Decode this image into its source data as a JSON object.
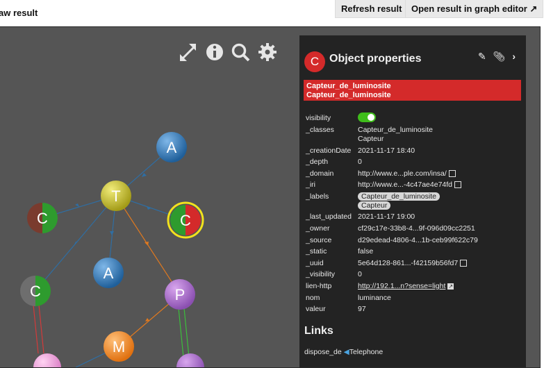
{
  "page": {
    "title": "aw result"
  },
  "buttons": {
    "refresh": "Refresh result",
    "open_editor": "Open result in graph editor"
  },
  "panel": {
    "icon_letter": "C",
    "title": "Object properties",
    "label_1": "Capteur_de_luminosite",
    "label_2": "Capteur_de_luminosite",
    "properties": [
      {
        "key": "visibility",
        "value": ""
      },
      {
        "key": "_classes",
        "value": "Capteur_de_luminosite",
        "value2": "Capteur"
      },
      {
        "key": "_creationDate",
        "value": "2021-11-17 18:40"
      },
      {
        "key": "_depth",
        "value": "0"
      },
      {
        "key": "_domain",
        "value": "http://www.e...ple.com/insa/"
      },
      {
        "key": "_iri",
        "value": "http://www.e...-4c47ae4e74fd"
      },
      {
        "key": "_labels",
        "value": "Capteur_de_luminosite",
        "value2": "Capteur"
      },
      {
        "key": "_last_updated",
        "value": "2021-11-17 19:00"
      },
      {
        "key": "_owner",
        "value": "cf29c17e-33b8-4...9f-096d09cc2251"
      },
      {
        "key": "_source",
        "value": "d29edead-4806-4...1b-ceb99f622c79"
      },
      {
        "key": "_static",
        "value": "false"
      },
      {
        "key": "_uuid",
        "value": "5e64d128-861...-f42159b56fd7"
      },
      {
        "key": "_visibility",
        "value": "0"
      },
      {
        "key": "lien-http",
        "value": "http://192.1...n?sense=light"
      },
      {
        "key": "nom",
        "value": "luminance"
      },
      {
        "key": "valeur",
        "value": "97"
      }
    ],
    "links_title": "Links",
    "link_row": {
      "key": "dispose_de",
      "target": "Telephone"
    }
  },
  "graph": {
    "nodes": [
      {
        "id": "A1",
        "letter": "A"
      },
      {
        "id": "T",
        "letter": "T"
      },
      {
        "id": "C1",
        "letter": "C"
      },
      {
        "id": "C2",
        "letter": "C"
      },
      {
        "id": "A2",
        "letter": "A"
      },
      {
        "id": "C3",
        "letter": "C"
      },
      {
        "id": "P",
        "letter": "P"
      },
      {
        "id": "M",
        "letter": "M"
      }
    ]
  },
  "colors": {
    "accent_red": "#d42a2a",
    "toggle_green": "#3fbd1b",
    "panel_bg": "#232323",
    "graph_bg": "#555555"
  }
}
